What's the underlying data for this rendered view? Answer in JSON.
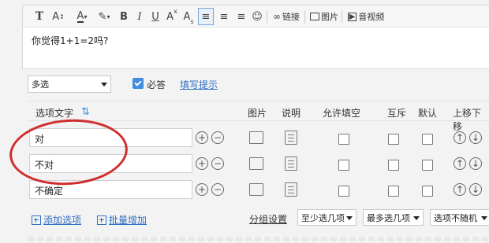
{
  "toolbar": {
    "link_label": "链接",
    "image_label": "图片",
    "video_label": "音视频"
  },
  "question": {
    "text": "你觉得1+1=2吗?"
  },
  "settings": {
    "type_select": "多选",
    "required_label": "必答",
    "hint_link": "填写提示"
  },
  "table": {
    "headers": {
      "option_text": "选项文字",
      "image": "图片",
      "description": "说明",
      "allow_fill": "允许填空",
      "exclusive": "互斥",
      "default": "默认",
      "move": "上移下移"
    },
    "options": [
      {
        "text": "对"
      },
      {
        "text": "不对"
      },
      {
        "text": "不确定"
      }
    ]
  },
  "footer": {
    "add_option": "添加选项",
    "bulk_add": "批量增加",
    "group_settings": "分组设置",
    "min_select": "至少选几项",
    "max_select": "最多选几项",
    "random": "选项不随机"
  },
  "colors": {
    "accent": "#3f8ee0",
    "link": "#2f6fc4",
    "annotation": "#d02e2e"
  }
}
